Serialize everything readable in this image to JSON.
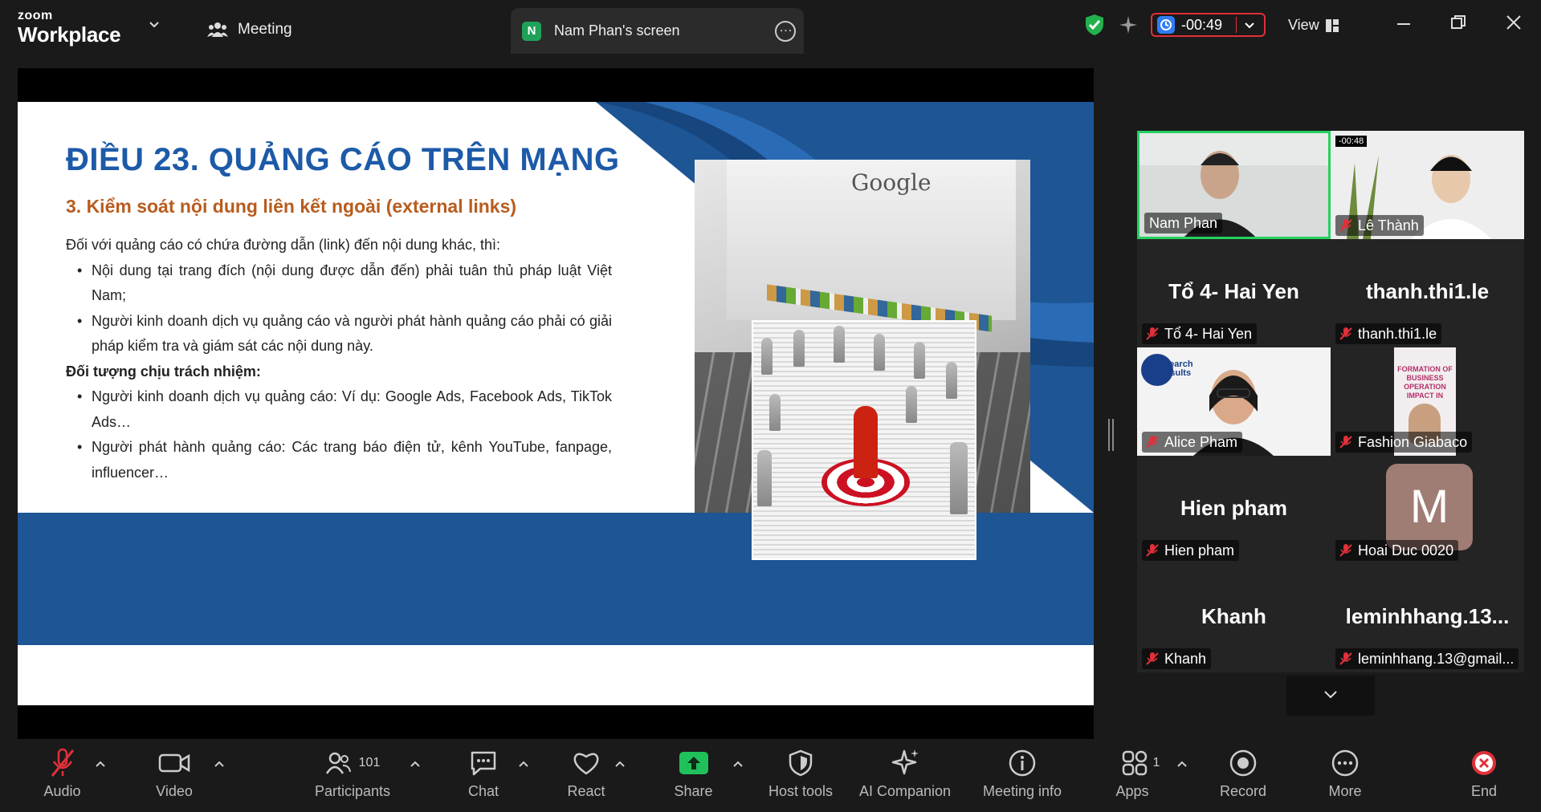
{
  "app": {
    "brand_small": "zoom",
    "brand_big": "Workplace"
  },
  "tabs": {
    "meeting": "Meeting",
    "screen_initial": "N",
    "screen_title": "Nam Phan's screen"
  },
  "header": {
    "timer": "-00:49",
    "view": "View"
  },
  "slide": {
    "title": "ĐIỀU 23. QUẢNG CÁO TRÊN MẠNG",
    "subtitle": "3. Kiểm soát nội dung liên kết ngoài (external links)",
    "intro": "Đối với quảng cáo có chứa đường dẫn (link) đến nội dung khác, thì:",
    "bullets1": [
      "Nội dung tại trang đích (nội dung được dẫn đến) phải tuân thủ pháp luật Việt Nam;",
      "Người kinh doanh dịch vụ quảng cáo và người phát hành quảng cáo phải có giải pháp kiểm tra và giám sát các nội dung này."
    ],
    "heading2": "Đối tượng chịu trách nhiệm:",
    "bullets2": [
      "Người kinh doanh dịch vụ quảng cáo: Ví dụ: Google Ads, Facebook Ads, TikTok Ads…",
      "Người phát hành quảng cáo: Các trang báo điện tử, kênh YouTube, fanpage, influencer…"
    ],
    "image_text": "Google"
  },
  "participants": [
    {
      "name": "Nam Phan",
      "big": "",
      "muted": false,
      "kind": "video-man"
    },
    {
      "name": "Lê Thành",
      "big": "",
      "muted": true,
      "kind": "video-young",
      "badge": "-00:48"
    },
    {
      "name": "Tổ 4- Hai Yen",
      "big": "Tổ 4- Hai Yen",
      "muted": true,
      "kind": "name"
    },
    {
      "name": "thanh.thi1.le",
      "big": "thanh.thi1.le",
      "muted": true,
      "kind": "name"
    },
    {
      "name": "Alice Pham",
      "big": "",
      "muted": true,
      "kind": "video-woman",
      "logo": "Research Consults"
    },
    {
      "name": "Fashion Giabaco",
      "big": "",
      "muted": true,
      "kind": "video-poster",
      "poster_text": "FORMATION OF BUSINESS OPERATION IMPACT IN"
    },
    {
      "name": "Hien pham",
      "big": "Hien pham",
      "muted": true,
      "kind": "name"
    },
    {
      "name": "Hoai Duc 0020",
      "big": "",
      "muted": true,
      "kind": "avatar",
      "avatar": "M"
    },
    {
      "name": "Khanh",
      "big": "Khanh",
      "muted": true,
      "kind": "name"
    },
    {
      "name": "leminhhang.13@gmail...",
      "big": "leminhhang.13...",
      "muted": true,
      "kind": "name"
    }
  ],
  "toolbar": {
    "audio": "Audio",
    "video": "Video",
    "participants": "Participants",
    "participants_count": "101",
    "chat": "Chat",
    "react": "React",
    "share": "Share",
    "host_tools": "Host tools",
    "ai_companion": "AI Companion",
    "meeting_info": "Meeting info",
    "apps": "Apps",
    "apps_count": "1",
    "record": "Record",
    "more": "More",
    "end": "End"
  },
  "colors": {
    "accent_green": "#23d160",
    "share_green": "#1fc15a",
    "end_red": "#e0303a",
    "slide_blue": "#1d5595",
    "title_blue": "#1d5aa8",
    "subtitle_orange": "#b85c1e"
  }
}
